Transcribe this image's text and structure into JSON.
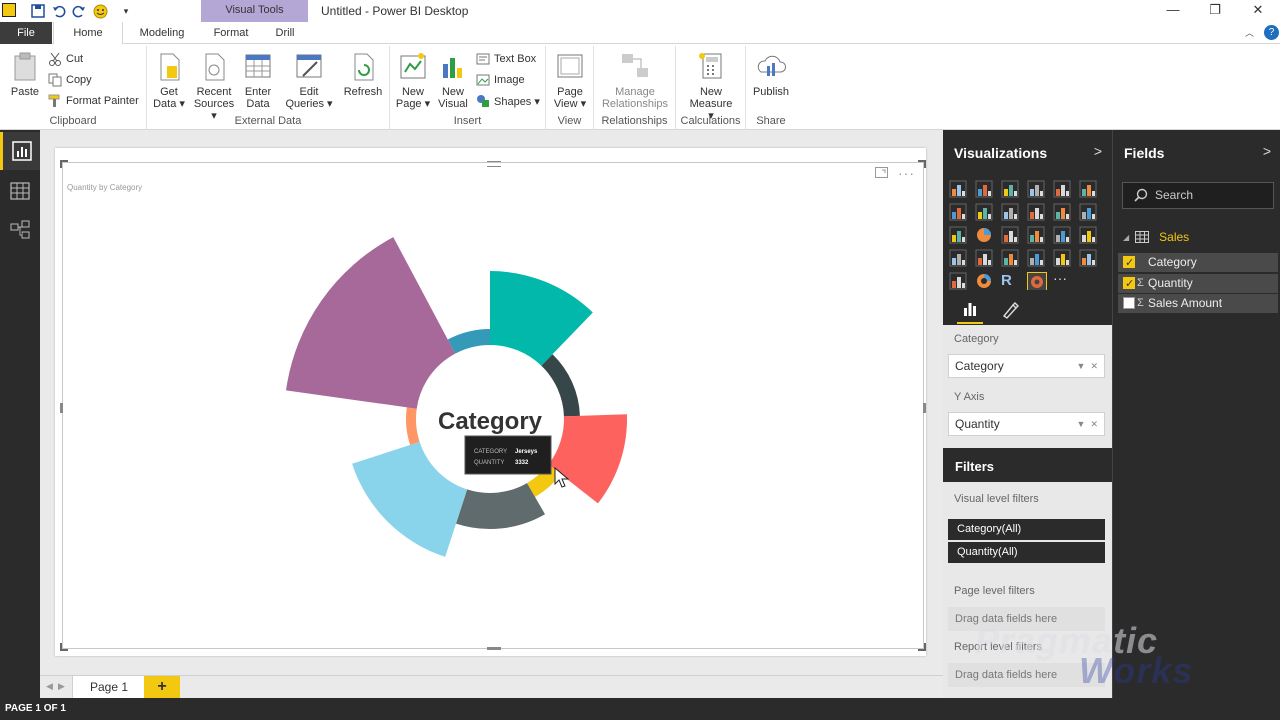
{
  "window": {
    "title": "Untitled - Power BI Desktop",
    "contextual_tab": "Visual Tools",
    "controls": {
      "minimize": "—",
      "restore": "❐",
      "close": "✕"
    }
  },
  "menu": {
    "file": "File",
    "tabs": [
      "Home",
      "Modeling",
      "Format",
      "Drill"
    ],
    "active_tab": "Home"
  },
  "ribbon": {
    "clipboard": {
      "label": "Clipboard",
      "paste": "Paste",
      "cut": "Cut",
      "copy": "Copy",
      "format_painter": "Format Painter"
    },
    "external_data": {
      "label": "External Data",
      "get_data": [
        "Get",
        "Data ▾"
      ],
      "recent_sources": [
        "Recent",
        "Sources ▾"
      ],
      "enter_data": [
        "Enter",
        "Data"
      ],
      "edit_queries": [
        "Edit",
        "Queries ▾"
      ],
      "refresh": "Refresh"
    },
    "insert": {
      "label": "Insert",
      "new_page": [
        "New",
        "Page ▾"
      ],
      "new_visual": [
        "New",
        "Visual"
      ],
      "text_box": "Text Box",
      "image": "Image",
      "shapes": "Shapes ▾"
    },
    "view": {
      "label": "View",
      "page_view": [
        "Page",
        "View ▾"
      ]
    },
    "relationships": {
      "label": "Relationships",
      "manage": [
        "Manage",
        "Relationships"
      ]
    },
    "calculations": {
      "label": "Calculations",
      "new_measure": [
        "New",
        "Measure ▾"
      ]
    },
    "share": {
      "label": "Share",
      "publish": "Publish"
    }
  },
  "report": {
    "visual_title": "Quantity by Category",
    "center_label": "Category",
    "tooltip": {
      "key1": "CATEGORY",
      "val1": "Jerseys",
      "key2": "QUANTITY",
      "val2": "3332"
    },
    "page_tab": "Page 1",
    "add_page": "+"
  },
  "chart_data": {
    "type": "pie",
    "note_style": "aster / radial donut",
    "center_label": "Category",
    "slices": [
      {
        "category": "Jerseys",
        "value": 3332,
        "color": "#f2c811"
      }
    ],
    "colors": [
      "#01b8aa",
      "#374649",
      "#fd625e",
      "#f2c811",
      "#5f6b6d",
      "#8ad4eb",
      "#fe9666",
      "#a66999",
      "#3599b8"
    ]
  },
  "status": {
    "page": "PAGE 1 OF 1"
  },
  "visualizations": {
    "title": "Visualizations",
    "category_label": "Category",
    "category_value": "Category",
    "yaxis_label": "Y Axis",
    "yaxis_value": "Quantity"
  },
  "filters": {
    "title": "Filters",
    "visual_level": "Visual level filters",
    "items": [
      "Category(All)",
      "Quantity(All)"
    ],
    "page_level": "Page level filters",
    "drop1": "Drag data fields here",
    "report_level": "Report level filters",
    "drop2": "Drag data fields here"
  },
  "fields": {
    "title": "Fields",
    "search_placeholder": "Search",
    "table": "Sales",
    "items": [
      {
        "name": "Category",
        "checked": true,
        "sigma": false
      },
      {
        "name": "Quantity",
        "checked": true,
        "sigma": true
      },
      {
        "name": "Sales Amount",
        "checked": false,
        "sigma": true
      }
    ]
  },
  "watermark": {
    "line1": "Pragmatic",
    "line2": "Works"
  },
  "colors": {
    "accent": "#f2c811",
    "dark": "#2b2b2b",
    "visual_tools": "#b4a7d6"
  }
}
